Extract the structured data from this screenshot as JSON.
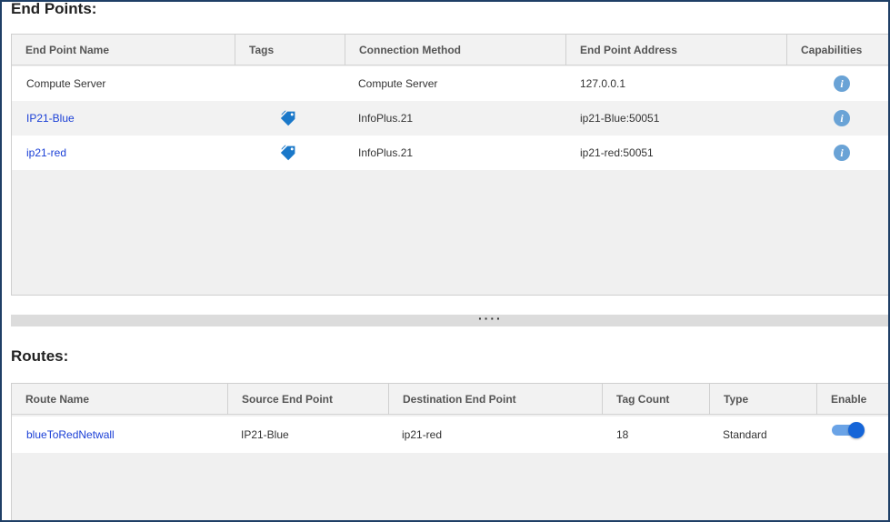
{
  "endpoints": {
    "title": "End Points:",
    "columns": [
      "End Point Name",
      "Tags",
      "Connection Method",
      "End Point Address",
      "Capabilities"
    ],
    "rows": [
      {
        "name": "Compute Server",
        "has_tags": false,
        "method": "Compute Server",
        "address": "127.0.0.1"
      },
      {
        "name": "IP21-Blue",
        "has_tags": true,
        "method": "InfoPlus.21",
        "address": "ip21-Blue:50051"
      },
      {
        "name": "ip21-red",
        "has_tags": true,
        "method": "InfoPlus.21",
        "address": "ip21-red:50051"
      }
    ]
  },
  "splitter": {
    "grip": "····"
  },
  "routes": {
    "title": "Routes:",
    "columns": [
      "Route Name",
      "Source End Point",
      "Destination End Point",
      "Tag Count",
      "Type",
      "Enable"
    ],
    "rows": [
      {
        "name": "blueToRedNetwall",
        "source": "IP21-Blue",
        "destination": "ip21-red",
        "tag_count": "18",
        "type": "Standard",
        "enabled": true
      }
    ]
  },
  "icons": {
    "info": "info-icon",
    "tags": "tags-icon"
  },
  "colors": {
    "link": "#1a3fd6",
    "accent": "#1565d8",
    "info": "#6aa3d6",
    "frame": "#1f3f66"
  }
}
